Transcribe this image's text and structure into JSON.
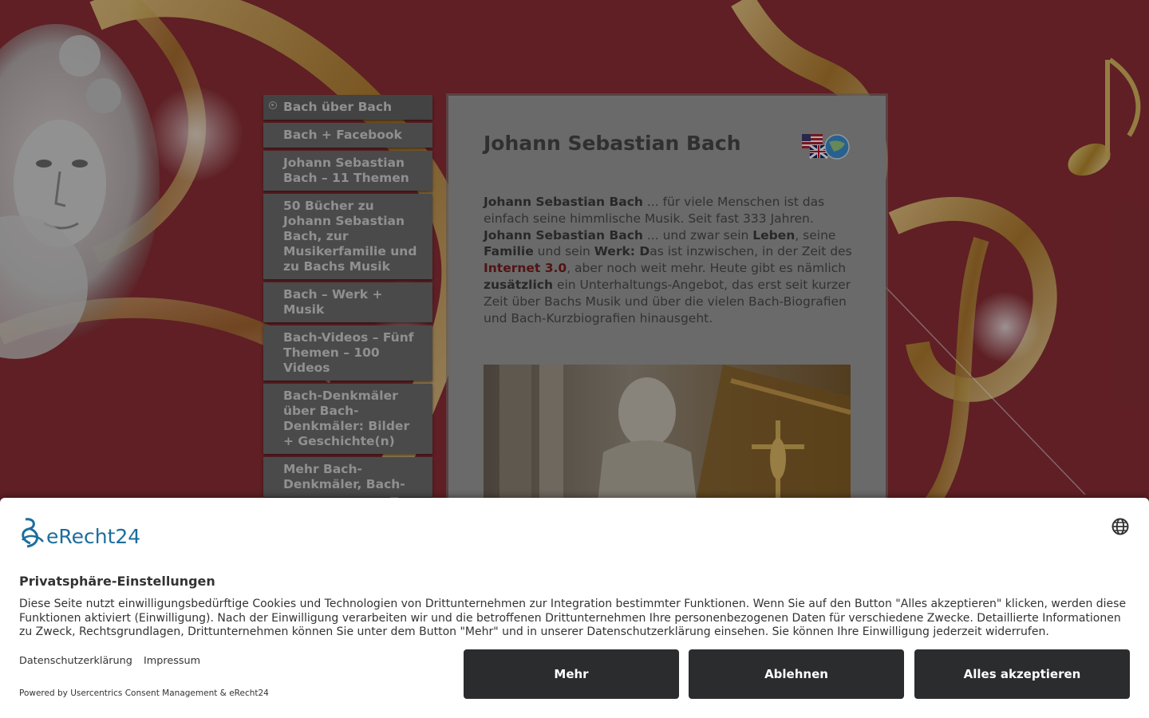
{
  "nav": {
    "items": [
      {
        "label": "Bach über Bach",
        "active": true
      },
      {
        "label": "Bach + Facebook"
      },
      {
        "label": "Johann Sebastian Bach – 11 Themen"
      },
      {
        "label": "50 Bücher zu Johann Sebastian Bach, zur Musikerfamilie und zu Bachs Musik"
      },
      {
        "label": "Bach – Werk + Musik"
      },
      {
        "label": "Bach-Videos – Fünf Themen – 100 Videos"
      },
      {
        "label": "Bach-Denkmäler über Bach-Denkmäler: Bilder + Geschichte(n)"
      },
      {
        "label": "Mehr Bach-Denkmäler, Bach-"
      }
    ]
  },
  "main": {
    "title": "Johann Sebastian Bach",
    "intro": {
      "p1": "Johann Sebastian Bach",
      "p2": " ... für viele Menschen ist das einfach seine himmlische Musik. Seit fast 333 Jahren. ",
      "p3": "Johann Sebastian Bach",
      "p4": " ... und zwar sein ",
      "p5": "Leben",
      "p6": ", seine ",
      "p7": "Familie",
      "p8": " und sein ",
      "p9": "Werk: D",
      "p10": "as ist inzwischen, in der Zeit des ",
      "p11": "Internet 3.0",
      "p12": ", aber noch weit mehr. Heute gibt es nämlich ",
      "p13": "zusätzlich",
      "p14": " ein Unterhaltungs-Angebot, das erst seit kurzer Zeit über Bachs Musik und über die vielen Bach-Biografien und Bach-Kurzbiografien hinausgeht."
    }
  },
  "consent": {
    "logo_text": "eRecht24",
    "title": "Privatsphäre-Einstellungen",
    "description": "Diese Seite nutzt einwilligungsbedürftige Cookies und Technologien von Drittunternehmen zur Integration bestimmter Funktionen. Wenn Sie auf den Button \"Alles akzeptieren\" klicken, werden diese Funktionen aktiviert (Einwilligung). Nach der Einwilligung verarbeiten wir und die betroffenen Drittunternehmen Ihre personenbezogenen Daten für verschiedene Zwecke. Detaillierte Informationen zu Zweck, Rechtsgrundlagen, Drittunternehmen können Sie unter dem Button \"Mehr\" und in unserer Datenschutzerklärung einsehen. Sie können Ihre Einwilligung jederzeit widerrufen.",
    "links": [
      "Datenschutzerklärung",
      "Impressum"
    ],
    "powered_by": "Powered by Usercentrics Consent Management & eRecht24",
    "buttons": {
      "more": "Mehr",
      "deny": "Ablehnen",
      "accept": "Alles akzeptieren"
    }
  },
  "colors": {
    "background": "#7a2a2f",
    "button": "#2b2c2e",
    "link": "#7a1c1e",
    "brand": "#1d6e9c"
  }
}
